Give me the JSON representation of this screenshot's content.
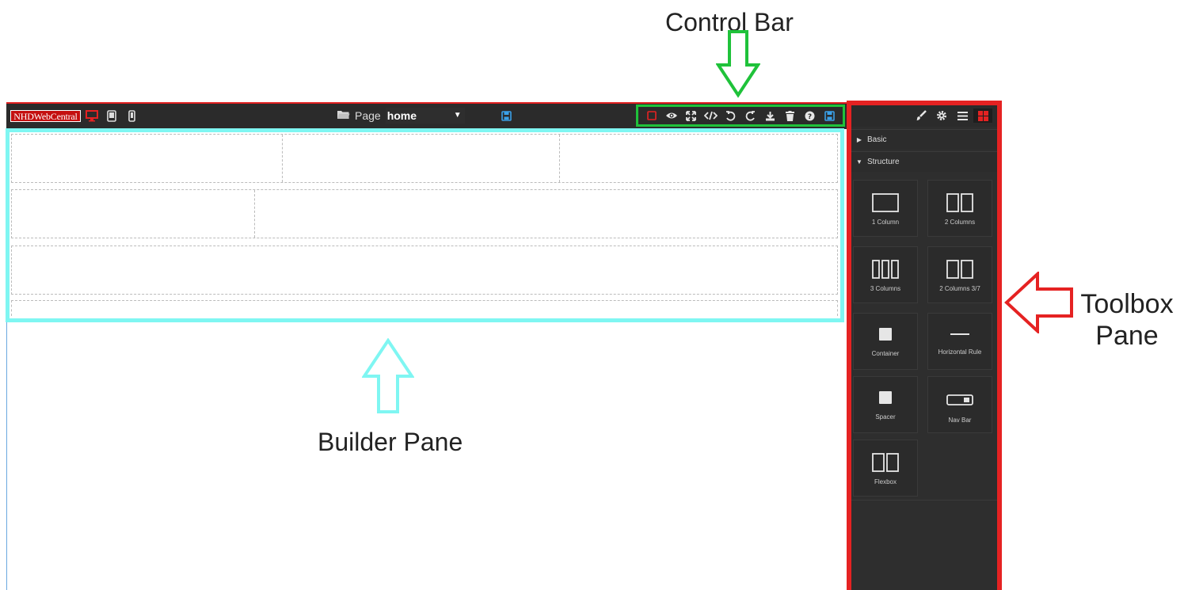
{
  "editor": {
    "logo_text": "NHDWebCentral",
    "page_label": "Page",
    "page_value": "home",
    "page_caret": "▼",
    "device_icons": [
      "desktop-icon",
      "tablet-icon",
      "mobile-icon"
    ],
    "control_icons": [
      "border-toggle-icon",
      "preview-eye-icon",
      "fullscreen-icon",
      "code-icon",
      "undo-icon",
      "redo-icon",
      "download-icon",
      "trash-icon",
      "help-icon",
      "save-icon"
    ]
  },
  "toolbox": {
    "header_icons": [
      "paintbrush-icon",
      "gear-icon",
      "layers-menu-icon",
      "blocks-icon"
    ],
    "categories": [
      {
        "label": "Basic",
        "expanded": false
      },
      {
        "label": "Structure",
        "expanded": true
      }
    ],
    "blocks": [
      {
        "label": "1 Column",
        "icon": "one-column-icon"
      },
      {
        "label": "2 Columns",
        "icon": "two-columns-icon"
      },
      {
        "label": "3 Columns",
        "icon": "three-columns-icon"
      },
      {
        "label": "2 Columns 3/7",
        "icon": "two-columns-37-icon"
      },
      {
        "label": "Container",
        "icon": "container-icon"
      },
      {
        "label": "Horizontal Rule",
        "icon": "hr-icon"
      },
      {
        "label": "Spacer",
        "icon": "spacer-icon"
      },
      {
        "label": "Nav Bar",
        "icon": "navbar-icon"
      },
      {
        "label": "Flexbox",
        "icon": "flexbox-icon"
      }
    ]
  },
  "annotations": {
    "control_bar": "Control Bar",
    "builder_pane": "Builder Pane",
    "toolbox_line1": "Toolbox",
    "toolbox_line2": "Pane"
  },
  "colors": {
    "control_bar_highlight": "#1fc23a",
    "builder_pane_highlight": "#7ff6f2",
    "toolbox_highlight": "#e52222",
    "accent_red": "#e02020",
    "accent_blue": "#3aa0e8"
  }
}
